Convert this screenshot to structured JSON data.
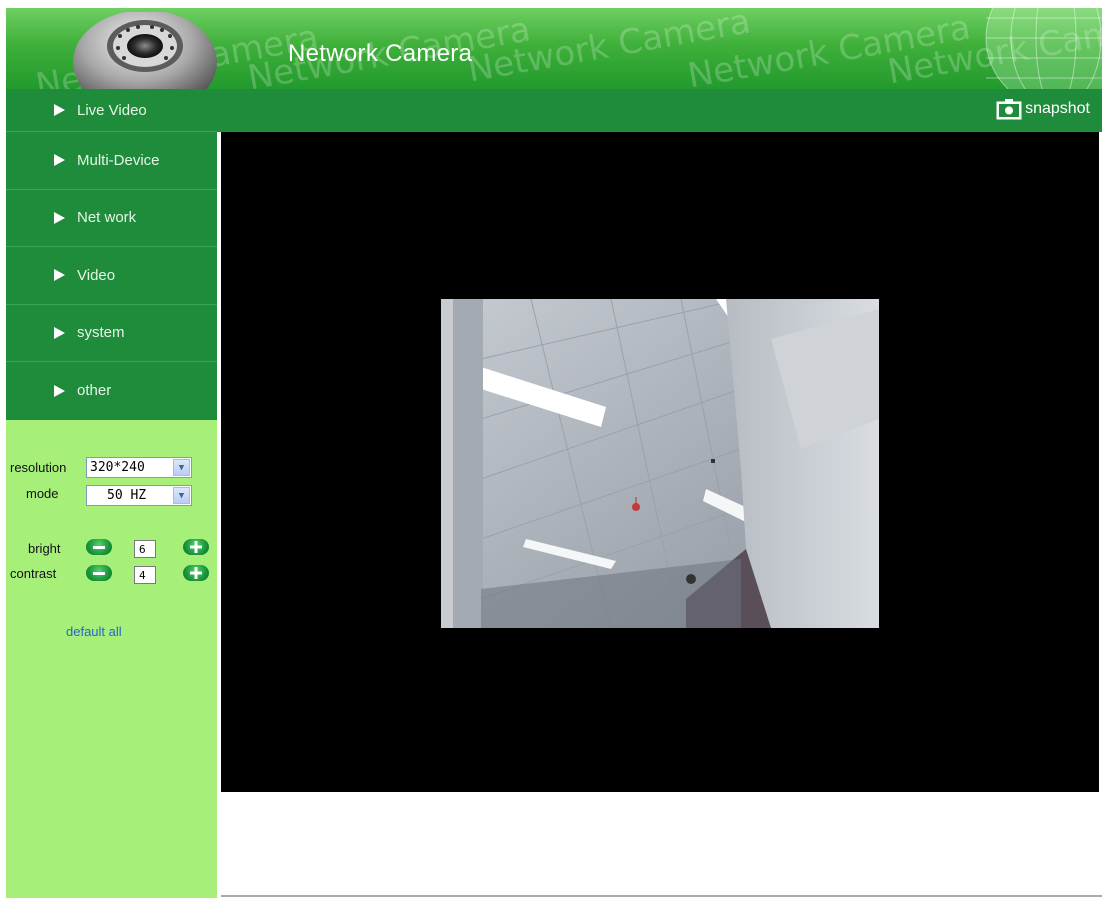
{
  "header": {
    "title": "Network Camera",
    "watermark_text": "Network Camera",
    "gradient_top": "#6fcf63",
    "gradient_bottom": "#229a2d"
  },
  "nav": {
    "items": [
      {
        "label": "Live Video"
      },
      {
        "label": "Multi-Device"
      },
      {
        "label": "Net work"
      },
      {
        "label": "Video"
      },
      {
        "label": "system"
      },
      {
        "label": "other"
      }
    ],
    "background": "#1f8c3c"
  },
  "controls": {
    "resolution_label": "resolution",
    "resolution_value": "320*240",
    "mode_label": "mode",
    "mode_value": "50 HZ",
    "bright_label": "bright",
    "bright_value": "6",
    "contrast_label": "contrast",
    "contrast_value": "4",
    "default_all_label": "default all",
    "panel_color": "#a6f07a"
  },
  "toolbar": {
    "snapshot_label": "snapshot",
    "snapshot_icon": "camera-icon"
  },
  "video": {
    "background": "#000000"
  }
}
